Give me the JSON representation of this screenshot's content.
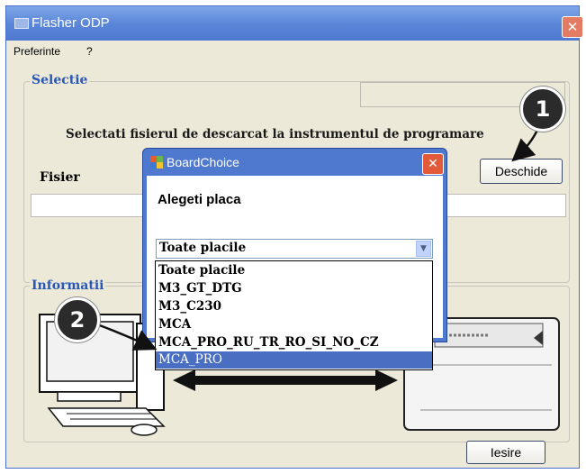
{
  "window": {
    "title": "Flasher ODP",
    "close_glyph": "✕"
  },
  "menu": {
    "items": [
      "Preferinte",
      "?"
    ]
  },
  "selectie": {
    "label": "Selectie",
    "instruction": "Selectati fisierul de descarcat la instrumentul de programare",
    "file_label": "Fisier",
    "open_button": "Deschide"
  },
  "informatii": {
    "label": "Informatii"
  },
  "exit_button": "Iesire",
  "callouts": [
    "1",
    "2"
  ],
  "dialog": {
    "title": "BoardChoice",
    "close_glyph": "✕",
    "prompt": "Alegeti placa",
    "selected_value": "Toate placile",
    "arrow_glyph": "▼",
    "options": [
      "Toate placile",
      "M3_GT_DTG",
      "M3_C230",
      "MCA",
      "MCA_PRO_RU_TR_RO_SI_NO_CZ",
      "MCA_PRO"
    ],
    "highlighted_option": "MCA_PRO"
  },
  "icons": [
    "app-icon",
    "close-icon",
    "board-choice-icon",
    "dropdown-arrow-icon",
    "computer-icon",
    "programmer-device-icon"
  ],
  "colors": {
    "title_bar": "#5b86d8",
    "group_label": "#2a58b5",
    "selection": "#4a6ec2",
    "callout": "#2b2b2b"
  }
}
